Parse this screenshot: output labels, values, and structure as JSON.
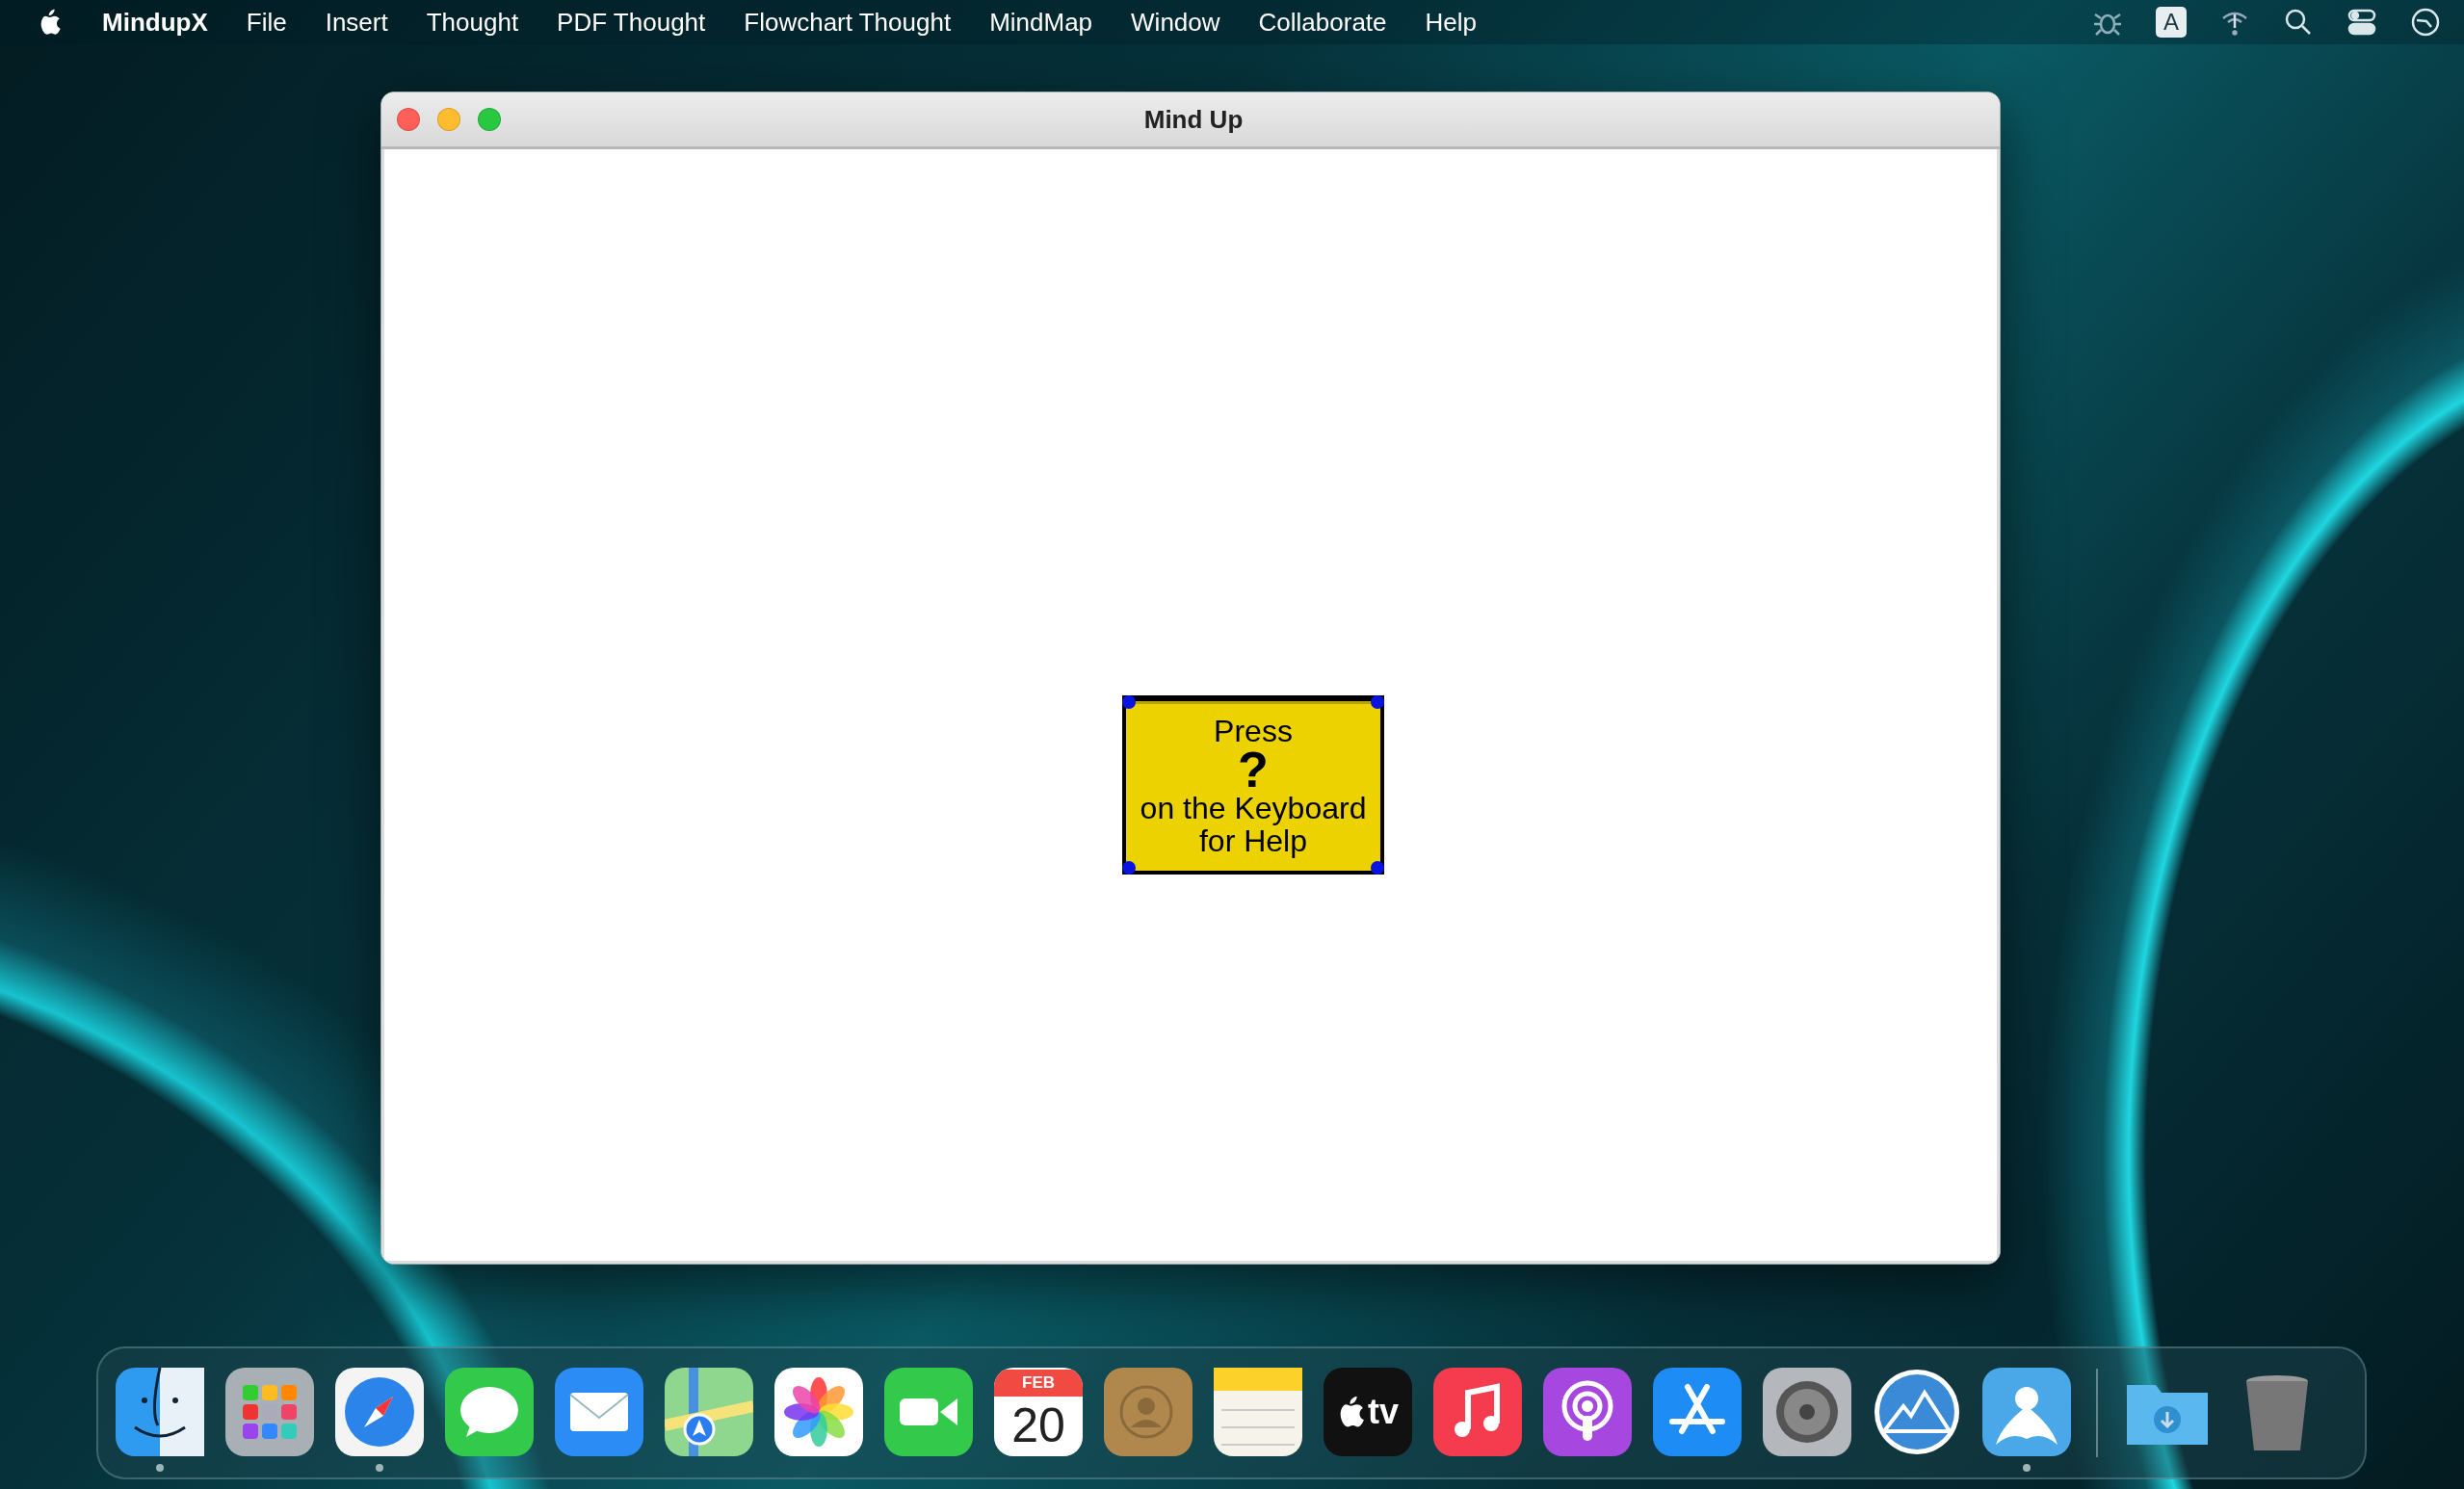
{
  "menu_bar": {
    "app_name": "MindupX",
    "menus": [
      "File",
      "Insert",
      "Thought",
      "PDF Thought",
      "Flowchart Thought",
      "MindMap",
      "Window",
      "Collaborate",
      "Help"
    ],
    "status_items": [
      {
        "kind": "bug"
      },
      {
        "kind": "input",
        "label": "A"
      },
      {
        "kind": "wifi"
      },
      {
        "kind": "search"
      },
      {
        "kind": "control"
      },
      {
        "kind": "clock"
      }
    ]
  },
  "window": {
    "title": "Mind Up",
    "thought": {
      "selected": true,
      "lines": [
        {
          "kind": "plain",
          "text": "Press"
        },
        {
          "kind": "key",
          "text": "?"
        },
        {
          "kind": "plain",
          "text": "on the Keyboard"
        },
        {
          "kind": "plain",
          "text": "for Help"
        }
      ]
    }
  },
  "dock": {
    "apps": [
      {
        "kind": "finder",
        "running": true
      },
      {
        "kind": "launchpad",
        "running": false
      },
      {
        "kind": "safari",
        "running": true
      },
      {
        "kind": "messages",
        "running": false
      },
      {
        "kind": "mail",
        "running": false
      },
      {
        "kind": "maps",
        "running": false
      },
      {
        "kind": "photos",
        "running": false
      },
      {
        "kind": "facetime",
        "running": false
      },
      {
        "kind": "calendar",
        "month": "FEB",
        "day": "20",
        "running": false
      },
      {
        "kind": "contacts",
        "running": false
      },
      {
        "kind": "notes",
        "running": false
      },
      {
        "kind": "tv",
        "label": "tv",
        "running": false
      },
      {
        "kind": "music",
        "running": false
      },
      {
        "kind": "podcasts",
        "running": false
      },
      {
        "kind": "appstore",
        "running": false
      },
      {
        "kind": "settings",
        "running": false
      },
      {
        "kind": "mountain",
        "running": false
      },
      {
        "kind": "mindup",
        "running": true
      }
    ],
    "others": [
      {
        "kind": "downloads"
      },
      {
        "kind": "trash"
      }
    ]
  }
}
